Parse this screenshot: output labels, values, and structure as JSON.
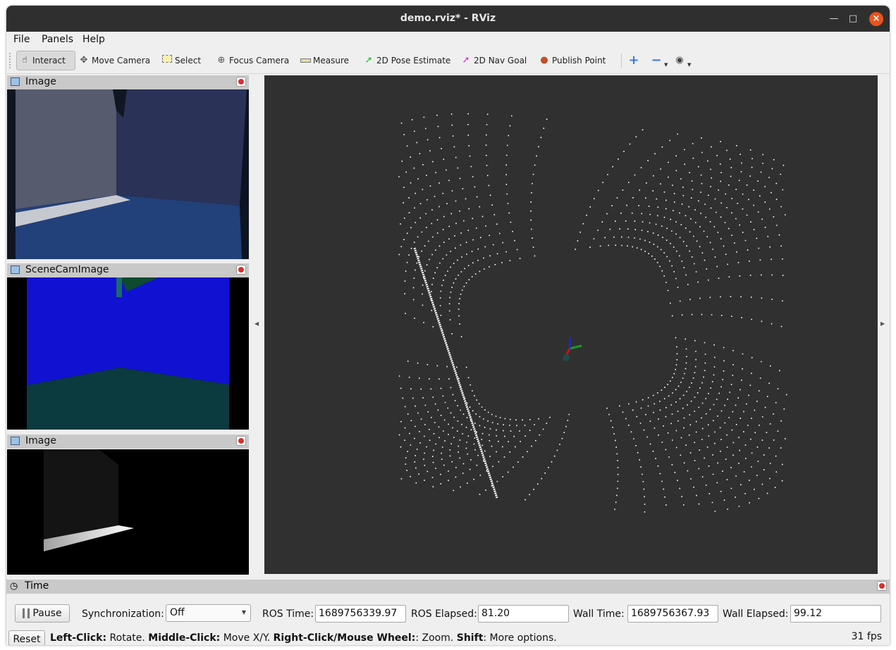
{
  "window": {
    "title": "demo.rviz* - RViz"
  },
  "menu": {
    "file": "File",
    "panels": "Panels",
    "help": "Help"
  },
  "toolbar": {
    "interact": "Interact",
    "move_camera": "Move Camera",
    "select": "Select",
    "focus_camera": "Focus Camera",
    "measure": "Measure",
    "pose_estimate": "2D Pose Estimate",
    "nav_goal": "2D Nav Goal",
    "publish_point": "Publish Point"
  },
  "panels": [
    {
      "title": "Image"
    },
    {
      "title": "SceneCamImage"
    },
    {
      "title": "Image"
    }
  ],
  "time": {
    "title": "Time",
    "pause_label": "Pause",
    "sync_label": "Synchronization:",
    "sync_value": "Off",
    "ros_time_label": "ROS Time:",
    "ros_time": "1689756339.97",
    "ros_elapsed_label": "ROS Elapsed:",
    "ros_elapsed": "81.20",
    "wall_time_label": "Wall Time:",
    "wall_time": "1689756367.93",
    "wall_elapsed_label": "Wall Elapsed:",
    "wall_elapsed": "99.12"
  },
  "status": {
    "reset_label": "Reset",
    "left_click": "Left-Click:",
    "left_desc": " Rotate. ",
    "middle_click": "Middle-Click:",
    "middle_desc": " Move X/Y. ",
    "right_click": "Right-Click/Mouse Wheel:",
    "right_desc": ": Zoom. ",
    "shift": "Shift",
    "shift_desc": ": More options.",
    "fps": "31 fps"
  }
}
